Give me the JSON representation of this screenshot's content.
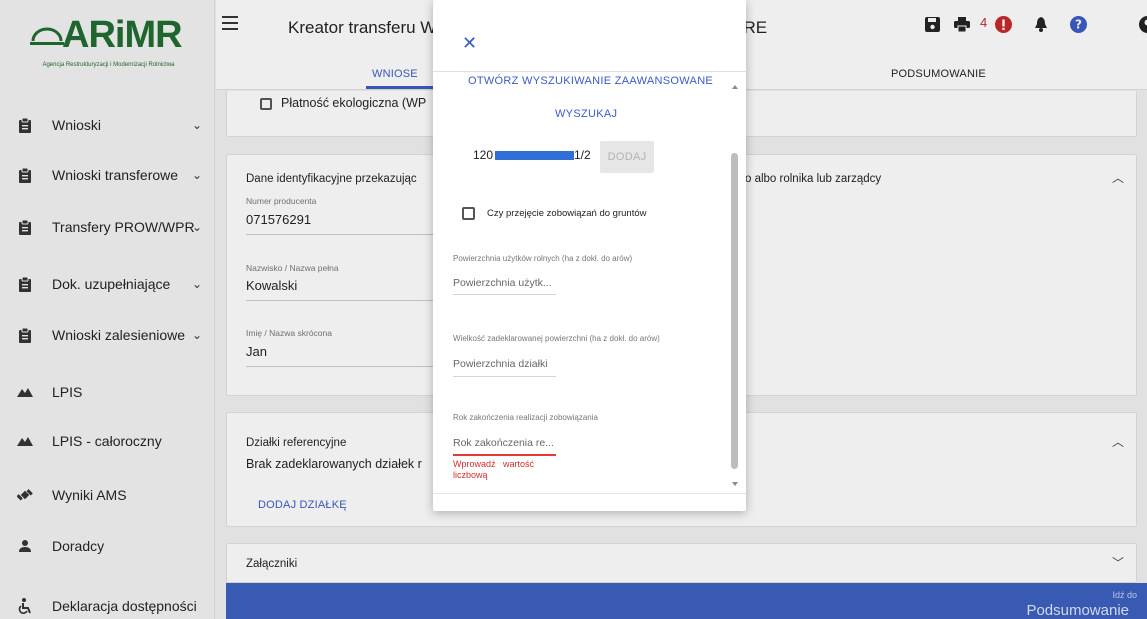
{
  "brand": {
    "logo_text": "ARiMR",
    "logo_subtitle": "Agencja Restrukturyzacji i Modernizacji Rolnictwa",
    "brand_color": "#1e6b2f"
  },
  "sidebar": {
    "items": [
      {
        "label": "Wnioski",
        "icon": "clipboard-icon",
        "chevron": "⌄"
      },
      {
        "label": "Wnioski transferowe",
        "icon": "clipboard-icon",
        "chevron": "⌄"
      },
      {
        "label": "Transfery PROW/WPR",
        "icon": "clipboard-icon",
        "chevron": "⌄"
      },
      {
        "label": "Dok. uzupełniające",
        "icon": "clipboard-icon",
        "chevron": "⌄"
      },
      {
        "label": "Wnioski zalesieniowe",
        "icon": "clipboard-icon",
        "chevron": "⌄"
      },
      {
        "label": "LPIS",
        "icon": "terrain-icon"
      },
      {
        "label": "LPIS - całoroczny",
        "icon": "terrain-icon"
      },
      {
        "label": "Wyniki AMS",
        "icon": "satellite-icon"
      },
      {
        "label": "Doradcy",
        "icon": "person-icon"
      },
      {
        "label": "Deklaracja dostępności",
        "icon": "accessibility-icon"
      }
    ]
  },
  "header": {
    "title": "Kreator transferu W",
    "title_right": "/IRE",
    "tabs": [
      {
        "label": "WNIOSEK",
        "visible_label": "WNIOSE"
      },
      {
        "label": "PODSUMOWANIE"
      }
    ],
    "notification_count": "4",
    "accent_color": "#3b5bc4"
  },
  "main": {
    "eco_payment_label": "Płatność ekologiczna (WP",
    "transferor_section": {
      "title": "Dane identyfikacyjne przekazując",
      "title_right": "o albo rolnika lub zarządcy",
      "fields": [
        {
          "label": "Numer producenta",
          "value": "071576291"
        },
        {
          "label": "Nazwisko / Nazwa pełna",
          "value": "Kowalski"
        },
        {
          "label": "Imię / Nazwa skrócona",
          "value": "Jan"
        }
      ]
    },
    "reference_parcels": {
      "title": "Działki referencyjne",
      "empty_text": "Brak zadeklarowanych działek r",
      "add_button": "DODAJ DZIAŁKĘ"
    },
    "attachments": {
      "title": "Załączniki"
    },
    "footer": {
      "go_to_small": "Idź do",
      "go_to_big": "Podsumowanie"
    }
  },
  "modal": {
    "close_icon": "✕",
    "advanced_search": "OTWÓRZ WYSZUKIWANIE ZAAWANSOWANE",
    "search": "WYSZUKAJ",
    "parcel_prefix": "120",
    "parcel_suffix": "1/2",
    "add_button": "DODAJ",
    "takeover_checkbox": "Czy przejęcie zobowiązań do gruntów",
    "fields": [
      {
        "label": "Powierzchnia użytków rolnych (ha z dokł. do arów)",
        "placeholder": "Powierzchnia użytk..."
      },
      {
        "label": "Wielkość zadeklarowanej powierzchni (ha z dokł. do arów)",
        "placeholder": "Powierzchnia działki"
      },
      {
        "label": "Rok zakończenia realizacji zobowiązania",
        "placeholder": "Rok zakończenia re..."
      }
    ],
    "error_line1": "Wprowadź   wartość",
    "error_line2": "liczbową",
    "error_color": "#d32f2f"
  }
}
